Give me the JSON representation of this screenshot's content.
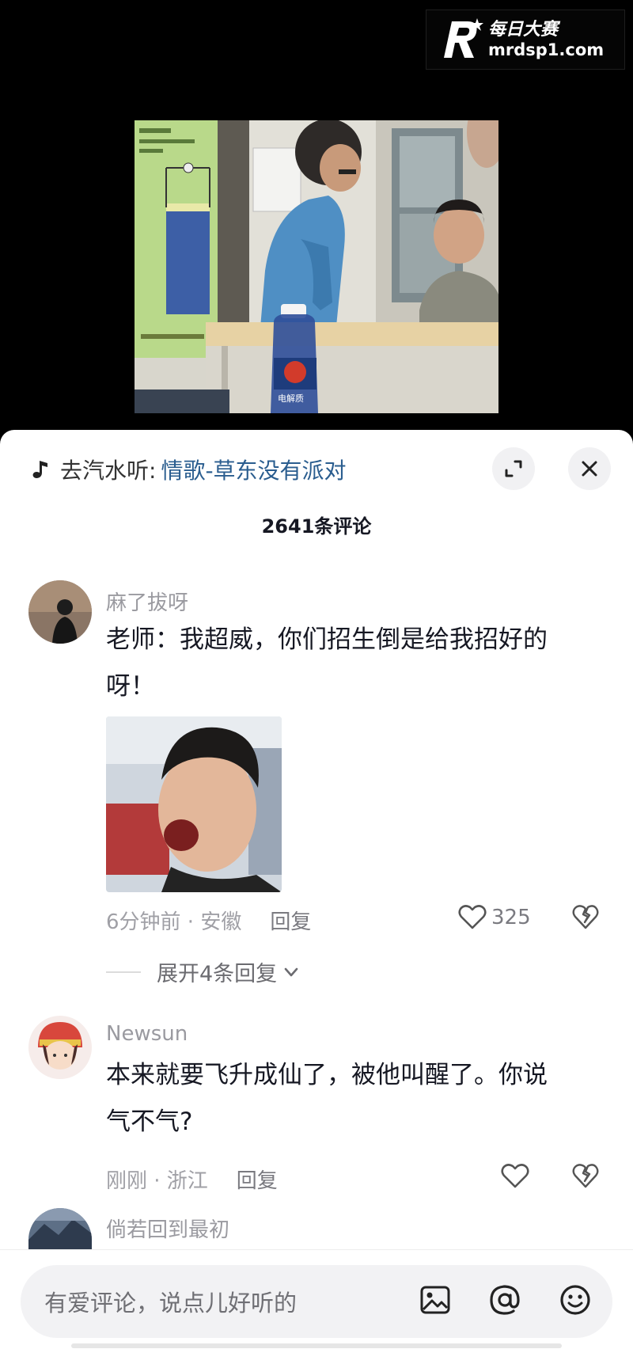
{
  "watermark": {
    "logo_letter": "R",
    "name": "每日大赛",
    "url": "mrdsp1.com"
  },
  "video": {
    "bottle_brand": "电解质"
  },
  "music": {
    "prefix": "去汽水听:",
    "title": "情歌-草东没有派对"
  },
  "comment_count": "2641条评论",
  "comments": [
    {
      "username": "麻了拔呀",
      "text_line1": "老师：我超威，你们招生倒是给我招好的",
      "text_line2": "呀！",
      "time_location": "6分钟前 · 安徽",
      "reply_label": "回复",
      "likes": "325",
      "expand_replies": "展开4条回复"
    },
    {
      "username": "Newsun",
      "text_line1": "本来就要飞升成仙了，被他叫醒了。你说",
      "text_line2": "气不气?",
      "time_location": "刚刚 · 浙江",
      "reply_label": "回复"
    },
    {
      "username": "倘若回到最初"
    }
  ],
  "input": {
    "placeholder": "有爱评论，说点儿好听的"
  },
  "icons": {
    "music": "music-note-icon",
    "expand": "expand-icon",
    "close": "close-icon",
    "like": "heart-outline-icon",
    "dislike": "broken-heart-icon",
    "image": "image-icon",
    "mention": "at-icon",
    "emoji": "emoji-icon",
    "chevron": "chevron-down-icon"
  },
  "colors": {
    "link": "#2a5d8f",
    "text": "#161823",
    "muted": "#9a9aa0",
    "sheet": "#ffffff",
    "backdrop": "#000000"
  }
}
